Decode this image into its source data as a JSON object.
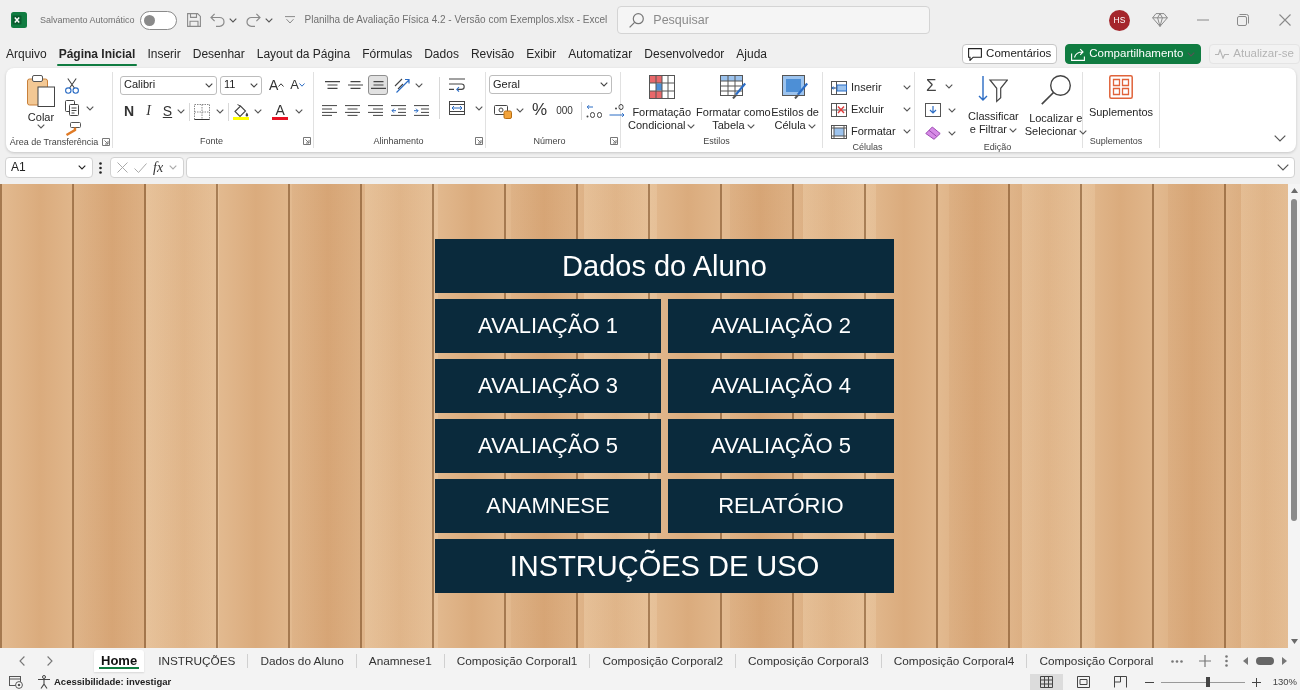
{
  "title_bar": {
    "autosave": {
      "label": "Salvamento Automático",
      "on": false
    },
    "title": "Planilha de Avaliação Física 4.2 - Versão com Exemplos.xlsx - Excel",
    "search": {
      "placeholder": "Pesquisar"
    },
    "avatar": "HS"
  },
  "ribbon": {
    "tabs": [
      {
        "label": "Arquivo",
        "selected": false
      },
      {
        "label": "Página Inicial",
        "selected": true
      },
      {
        "label": "Inserir",
        "selected": false
      },
      {
        "label": "Desenhar",
        "selected": false
      },
      {
        "label": "Layout da Página",
        "selected": false
      },
      {
        "label": "Fórmulas",
        "selected": false
      },
      {
        "label": "Dados",
        "selected": false
      },
      {
        "label": "Revisão",
        "selected": false
      },
      {
        "label": "Exibir",
        "selected": false
      },
      {
        "label": "Automatizar",
        "selected": false
      },
      {
        "label": "Desenvolvedor",
        "selected": false
      },
      {
        "label": "Ajuda",
        "selected": false
      }
    ],
    "actions": [
      {
        "kind": "comments",
        "label": "Comentários",
        "disabled": false
      },
      {
        "kind": "share",
        "label": "Compartilhamento",
        "disabled": false
      },
      {
        "kind": "update",
        "label": "Atualizar-se",
        "disabled": true
      }
    ],
    "groups": [
      {
        "kind": "clipboard",
        "label": "Área de Transferência",
        "launcher": true,
        "paste": "Colar"
      },
      {
        "kind": "font",
        "label": "Fonte",
        "launcher": true,
        "font_name": "Calibri",
        "font_size": "11",
        "grow": "A",
        "shrink": "A",
        "bold": "N",
        "italic": "I",
        "underline": "S",
        "font_color": "A"
      },
      {
        "kind": "alignment",
        "label": "Alinhamento",
        "launcher": true,
        "vertical_align": [
          {
            "selected": false
          },
          {
            "selected": false
          },
          {
            "selected": true
          }
        ]
      },
      {
        "kind": "number",
        "label": "Número",
        "launcher": true,
        "format": "Geral",
        "percent": "%",
        "thousands": "000"
      },
      {
        "kind": "styles",
        "label": "Estilos",
        "launcher": false,
        "buttons": [
          {
            "lines": [
              "Formatação",
              "Condicional"
            ]
          },
          {
            "lines": [
              "Formatar como",
              "Tabela"
            ]
          },
          {
            "lines": [
              "Estilos de",
              "Célula"
            ]
          }
        ]
      },
      {
        "kind": "cells",
        "label": "Células",
        "launcher": false,
        "buttons": [
          {
            "label": "Inserir"
          },
          {
            "label": "Excluir"
          },
          {
            "label": "Formatar"
          }
        ]
      },
      {
        "kind": "editing",
        "label": "Edição",
        "launcher": false,
        "sum": "Σ",
        "buttons": [
          {
            "lines": [
              "Classificar",
              "e Filtrar"
            ]
          },
          {
            "lines": [
              "Localizar e",
              "Selecionar"
            ]
          }
        ]
      },
      {
        "kind": "addins",
        "label": "Suplementos",
        "launcher": false,
        "buttons": [
          {
            "lines": [
              "Suplementos"
            ]
          }
        ]
      }
    ]
  },
  "formula_bar": {
    "name_box": "A1",
    "function_label": "fx"
  },
  "sheet": {
    "menu": [
      {
        "kind": "wide",
        "label": "Dados do Aluno"
      },
      {
        "kind": "half",
        "label": "AVALIAÇÃO 1"
      },
      {
        "kind": "half",
        "label": "AVALIAÇÃO 2"
      },
      {
        "kind": "half",
        "label": "AVALIAÇÃO 3"
      },
      {
        "kind": "half",
        "label": "AVALIAÇÃO 4"
      },
      {
        "kind": "half",
        "label": "AVALIAÇÃO 5"
      },
      {
        "kind": "half",
        "label": "AVALIAÇÃO 5"
      },
      {
        "kind": "half",
        "label": "ANAMNESE"
      },
      {
        "kind": "half",
        "label": "RELATÓRIO"
      },
      {
        "kind": "wide",
        "label": "INSTRUÇÕES DE USO"
      }
    ]
  },
  "sheet_tabs": [
    {
      "label": "Home",
      "selected": true
    },
    {
      "label": "INSTRUÇÕES",
      "selected": false
    },
    {
      "label": "Dados do Aluno",
      "selected": false
    },
    {
      "label": "Anamnese1",
      "selected": false
    },
    {
      "label": "Composição Corporal1",
      "selected": false
    },
    {
      "label": "Composição Corporal2",
      "selected": false
    },
    {
      "label": "Composição Corporal3",
      "selected": false
    },
    {
      "label": "Composição Corporal4",
      "selected": false
    },
    {
      "label": "Composição Corporal",
      "selected": false
    }
  ],
  "status_bar": {
    "accessibility": "Acessibilidade: investigar",
    "views": [
      {
        "selected": true
      },
      {
        "selected": false
      },
      {
        "selected": false
      }
    ],
    "zoom": {
      "level": 0.56,
      "reading": "130%"
    }
  }
}
